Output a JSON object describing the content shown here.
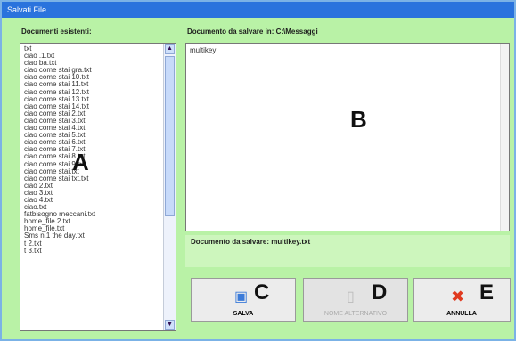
{
  "window": {
    "title": "Salvati File"
  },
  "left_panel": {
    "label": "Documenti esistenti:",
    "marker": "A",
    "items": [
      "txt",
      "ciao .1.txt",
      "ciao ba.txt",
      "ciao come stai gra.txt",
      "ciao come stai 10.txt",
      "ciao come stai 11.txt",
      "ciao come stai 12.txt",
      "ciao come stai 13.txt",
      "ciao come stai 14.txt",
      "ciao come stai 2.txt",
      "ciao come stai 3.txt",
      "ciao come stai 4.txt",
      "ciao come stai 5.txt",
      "ciao come stai 6.txt",
      "ciao come stai 7.txt",
      "ciao come stai 8.txt",
      "ciao come stai 9.txt",
      "ciao come stai.txt",
      "ciao come stai txt.txt",
      "ciao 2.txt",
      "ciao 3.txt",
      "ciao 4.txt",
      "ciao.txt",
      "fatbisogno rneccani.txt",
      "home_file 2.txt",
      "home_file.txt",
      "Sms n.1 the day.txt",
      "t 2.txt",
      "t 3.txt"
    ]
  },
  "right_panel": {
    "label": "Documento da salvare in: C:\\Messaggi",
    "content": "multikey",
    "marker": "B"
  },
  "status": {
    "text": "Documento da salvare: multikey.txt"
  },
  "buttons": {
    "save": {
      "label": "SALVA",
      "marker": "C",
      "icon": "floppy-disk-icon"
    },
    "alt_name": {
      "label": "NOME ALTERNATIVO",
      "marker": "D",
      "icon": "document-icon"
    },
    "cancel": {
      "label": "ANNULLA",
      "marker": "E",
      "icon": "red-x-icon"
    }
  },
  "colors": {
    "background": "#b9f2a6",
    "title_bar": "#2a73dd",
    "cancel_icon": "#e03a1f",
    "save_icon": "#3b7bd9"
  }
}
